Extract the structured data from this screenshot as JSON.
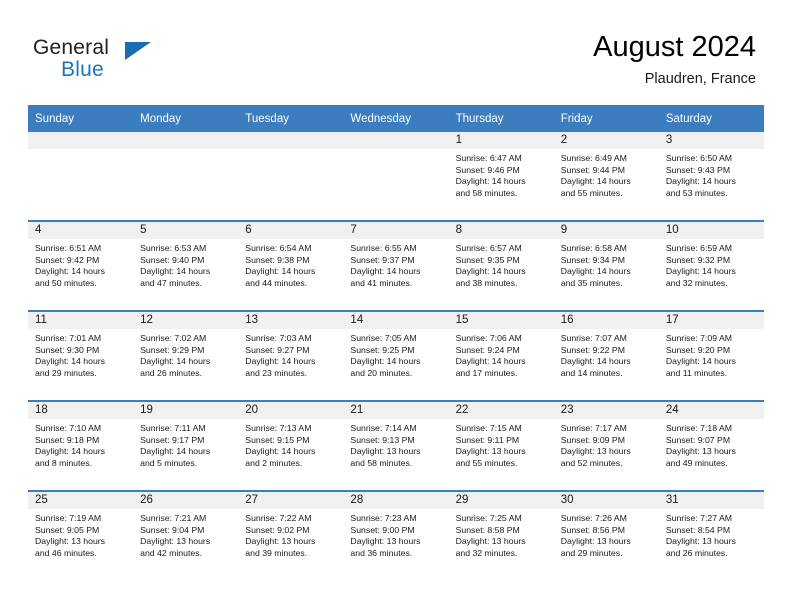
{
  "brand": {
    "name_part1": "General",
    "name_part2": "Blue",
    "logo_icon": "triangle-flag-icon"
  },
  "header": {
    "title": "August 2024",
    "subtitle": "Plaudren, France"
  },
  "weekday_headers": [
    "Sunday",
    "Monday",
    "Tuesday",
    "Wednesday",
    "Thursday",
    "Friday",
    "Saturday"
  ],
  "colors": {
    "header_blue": "#3b7dbf",
    "brand_blue": "#1b75bb",
    "daynum_band": "#f0f0f0",
    "text": "#1a1a1a"
  },
  "labels": {
    "sunrise_prefix": "Sunrise:",
    "sunset_prefix": "Sunset:",
    "daylight_prefix": "Daylight:"
  },
  "weeks": [
    [
      {
        "day": "",
        "lines": []
      },
      {
        "day": "",
        "lines": []
      },
      {
        "day": "",
        "lines": []
      },
      {
        "day": "",
        "lines": []
      },
      {
        "day": "1",
        "lines": [
          "Sunrise: 6:47 AM",
          "Sunset: 9:46 PM",
          "Daylight: 14 hours",
          "and 58 minutes."
        ]
      },
      {
        "day": "2",
        "lines": [
          "Sunrise: 6:49 AM",
          "Sunset: 9:44 PM",
          "Daylight: 14 hours",
          "and 55 minutes."
        ]
      },
      {
        "day": "3",
        "lines": [
          "Sunrise: 6:50 AM",
          "Sunset: 9:43 PM",
          "Daylight: 14 hours",
          "and 53 minutes."
        ]
      }
    ],
    [
      {
        "day": "4",
        "lines": [
          "Sunrise: 6:51 AM",
          "Sunset: 9:42 PM",
          "Daylight: 14 hours",
          "and 50 minutes."
        ]
      },
      {
        "day": "5",
        "lines": [
          "Sunrise: 6:53 AM",
          "Sunset: 9:40 PM",
          "Daylight: 14 hours",
          "and 47 minutes."
        ]
      },
      {
        "day": "6",
        "lines": [
          "Sunrise: 6:54 AM",
          "Sunset: 9:38 PM",
          "Daylight: 14 hours",
          "and 44 minutes."
        ]
      },
      {
        "day": "7",
        "lines": [
          "Sunrise: 6:55 AM",
          "Sunset: 9:37 PM",
          "Daylight: 14 hours",
          "and 41 minutes."
        ]
      },
      {
        "day": "8",
        "lines": [
          "Sunrise: 6:57 AM",
          "Sunset: 9:35 PM",
          "Daylight: 14 hours",
          "and 38 minutes."
        ]
      },
      {
        "day": "9",
        "lines": [
          "Sunrise: 6:58 AM",
          "Sunset: 9:34 PM",
          "Daylight: 14 hours",
          "and 35 minutes."
        ]
      },
      {
        "day": "10",
        "lines": [
          "Sunrise: 6:59 AM",
          "Sunset: 9:32 PM",
          "Daylight: 14 hours",
          "and 32 minutes."
        ]
      }
    ],
    [
      {
        "day": "11",
        "lines": [
          "Sunrise: 7:01 AM",
          "Sunset: 9:30 PM",
          "Daylight: 14 hours",
          "and 29 minutes."
        ]
      },
      {
        "day": "12",
        "lines": [
          "Sunrise: 7:02 AM",
          "Sunset: 9:29 PM",
          "Daylight: 14 hours",
          "and 26 minutes."
        ]
      },
      {
        "day": "13",
        "lines": [
          "Sunrise: 7:03 AM",
          "Sunset: 9:27 PM",
          "Daylight: 14 hours",
          "and 23 minutes."
        ]
      },
      {
        "day": "14",
        "lines": [
          "Sunrise: 7:05 AM",
          "Sunset: 9:25 PM",
          "Daylight: 14 hours",
          "and 20 minutes."
        ]
      },
      {
        "day": "15",
        "lines": [
          "Sunrise: 7:06 AM",
          "Sunset: 9:24 PM",
          "Daylight: 14 hours",
          "and 17 minutes."
        ]
      },
      {
        "day": "16",
        "lines": [
          "Sunrise: 7:07 AM",
          "Sunset: 9:22 PM",
          "Daylight: 14 hours",
          "and 14 minutes."
        ]
      },
      {
        "day": "17",
        "lines": [
          "Sunrise: 7:09 AM",
          "Sunset: 9:20 PM",
          "Daylight: 14 hours",
          "and 11 minutes."
        ]
      }
    ],
    [
      {
        "day": "18",
        "lines": [
          "Sunrise: 7:10 AM",
          "Sunset: 9:18 PM",
          "Daylight: 14 hours",
          "and 8 minutes."
        ]
      },
      {
        "day": "19",
        "lines": [
          "Sunrise: 7:11 AM",
          "Sunset: 9:17 PM",
          "Daylight: 14 hours",
          "and 5 minutes."
        ]
      },
      {
        "day": "20",
        "lines": [
          "Sunrise: 7:13 AM",
          "Sunset: 9:15 PM",
          "Daylight: 14 hours",
          "and 2 minutes."
        ]
      },
      {
        "day": "21",
        "lines": [
          "Sunrise: 7:14 AM",
          "Sunset: 9:13 PM",
          "Daylight: 13 hours",
          "and 58 minutes."
        ]
      },
      {
        "day": "22",
        "lines": [
          "Sunrise: 7:15 AM",
          "Sunset: 9:11 PM",
          "Daylight: 13 hours",
          "and 55 minutes."
        ]
      },
      {
        "day": "23",
        "lines": [
          "Sunrise: 7:17 AM",
          "Sunset: 9:09 PM",
          "Daylight: 13 hours",
          "and 52 minutes."
        ]
      },
      {
        "day": "24",
        "lines": [
          "Sunrise: 7:18 AM",
          "Sunset: 9:07 PM",
          "Daylight: 13 hours",
          "and 49 minutes."
        ]
      }
    ],
    [
      {
        "day": "25",
        "lines": [
          "Sunrise: 7:19 AM",
          "Sunset: 9:05 PM",
          "Daylight: 13 hours",
          "and 46 minutes."
        ]
      },
      {
        "day": "26",
        "lines": [
          "Sunrise: 7:21 AM",
          "Sunset: 9:04 PM",
          "Daylight: 13 hours",
          "and 42 minutes."
        ]
      },
      {
        "day": "27",
        "lines": [
          "Sunrise: 7:22 AM",
          "Sunset: 9:02 PM",
          "Daylight: 13 hours",
          "and 39 minutes."
        ]
      },
      {
        "day": "28",
        "lines": [
          "Sunrise: 7:23 AM",
          "Sunset: 9:00 PM",
          "Daylight: 13 hours",
          "and 36 minutes."
        ]
      },
      {
        "day": "29",
        "lines": [
          "Sunrise: 7:25 AM",
          "Sunset: 8:58 PM",
          "Daylight: 13 hours",
          "and 32 minutes."
        ]
      },
      {
        "day": "30",
        "lines": [
          "Sunrise: 7:26 AM",
          "Sunset: 8:56 PM",
          "Daylight: 13 hours",
          "and 29 minutes."
        ]
      },
      {
        "day": "31",
        "lines": [
          "Sunrise: 7:27 AM",
          "Sunset: 8:54 PM",
          "Daylight: 13 hours",
          "and 26 minutes."
        ]
      }
    ]
  ]
}
